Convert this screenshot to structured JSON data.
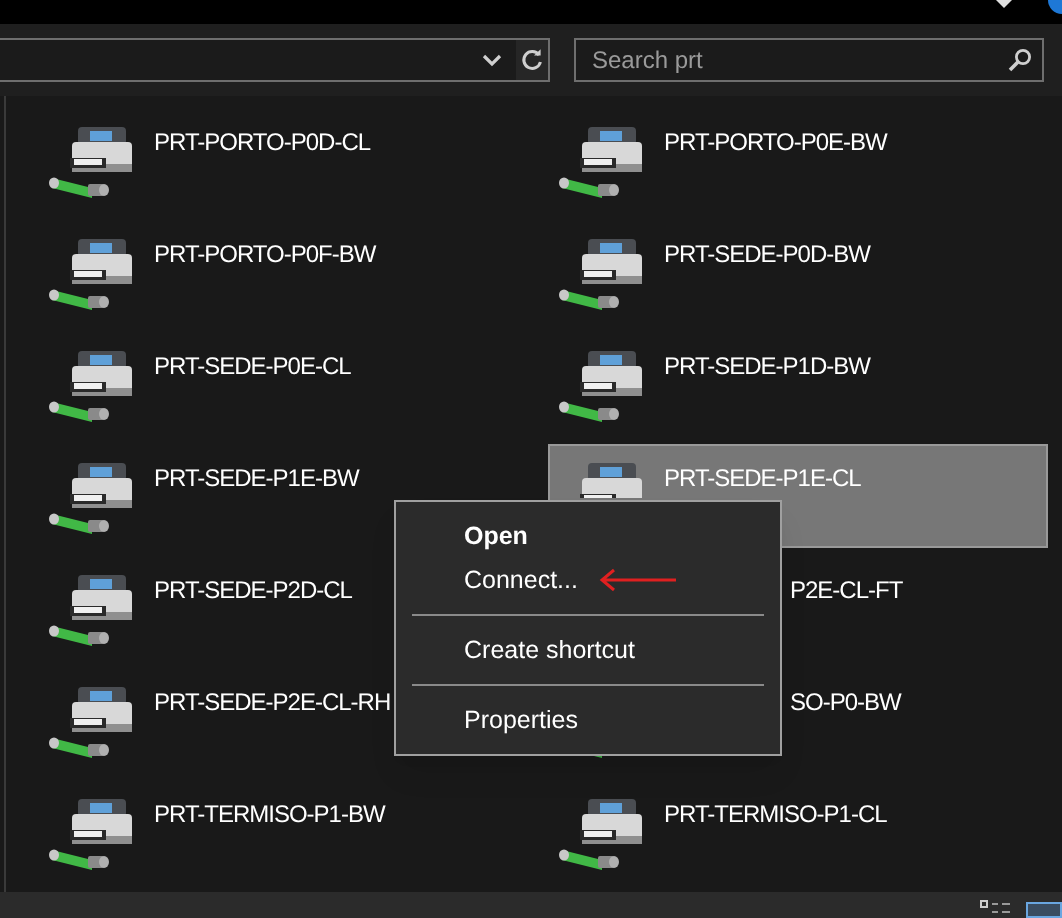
{
  "search": {
    "placeholder": "Search prt"
  },
  "items": [
    {
      "name": "PRT-PORTO-P0D-CL",
      "selected": false,
      "kind": "full"
    },
    {
      "name": "PRT-PORTO-P0E-BW",
      "selected": false,
      "kind": "full"
    },
    {
      "name": "PRT-PORTO-P0F-BW",
      "selected": false,
      "kind": "full"
    },
    {
      "name": "PRT-SEDE-P0D-BW",
      "selected": false,
      "kind": "full"
    },
    {
      "name": "PRT-SEDE-P0E-CL",
      "selected": false,
      "kind": "full"
    },
    {
      "name": "PRT-SEDE-P1D-BW",
      "selected": false,
      "kind": "full"
    },
    {
      "name": "PRT-SEDE-P1E-BW",
      "selected": false,
      "kind": "full"
    },
    {
      "name": "PRT-SEDE-P1E-CL",
      "selected": true,
      "kind": "icon_top_only"
    },
    {
      "name": "PRT-SEDE-P2D-CL",
      "selected": false,
      "kind": "full"
    },
    {
      "name": "P2E-CL-FT",
      "selected": false,
      "kind": "under_menu"
    },
    {
      "name": "PRT-SEDE-P2E-CL-RH",
      "selected": false,
      "kind": "full"
    },
    {
      "name": "SO-P0-BW",
      "selected": false,
      "kind": "under_menu_icon_bottom"
    },
    {
      "name": "PRT-TERMISO-P1-BW",
      "selected": false,
      "kind": "full"
    },
    {
      "name": "PRT-TERMISO-P1-CL",
      "selected": false,
      "kind": "full"
    }
  ],
  "context_menu": [
    {
      "label": "Open",
      "kind": "default"
    },
    {
      "label": "Connect...",
      "kind": "item",
      "annotated": true
    },
    {
      "kind": "separator"
    },
    {
      "label": "Create shortcut",
      "kind": "item",
      "annotated": false
    },
    {
      "kind": "separator"
    },
    {
      "label": "Properties",
      "kind": "item",
      "annotated": false
    }
  ]
}
